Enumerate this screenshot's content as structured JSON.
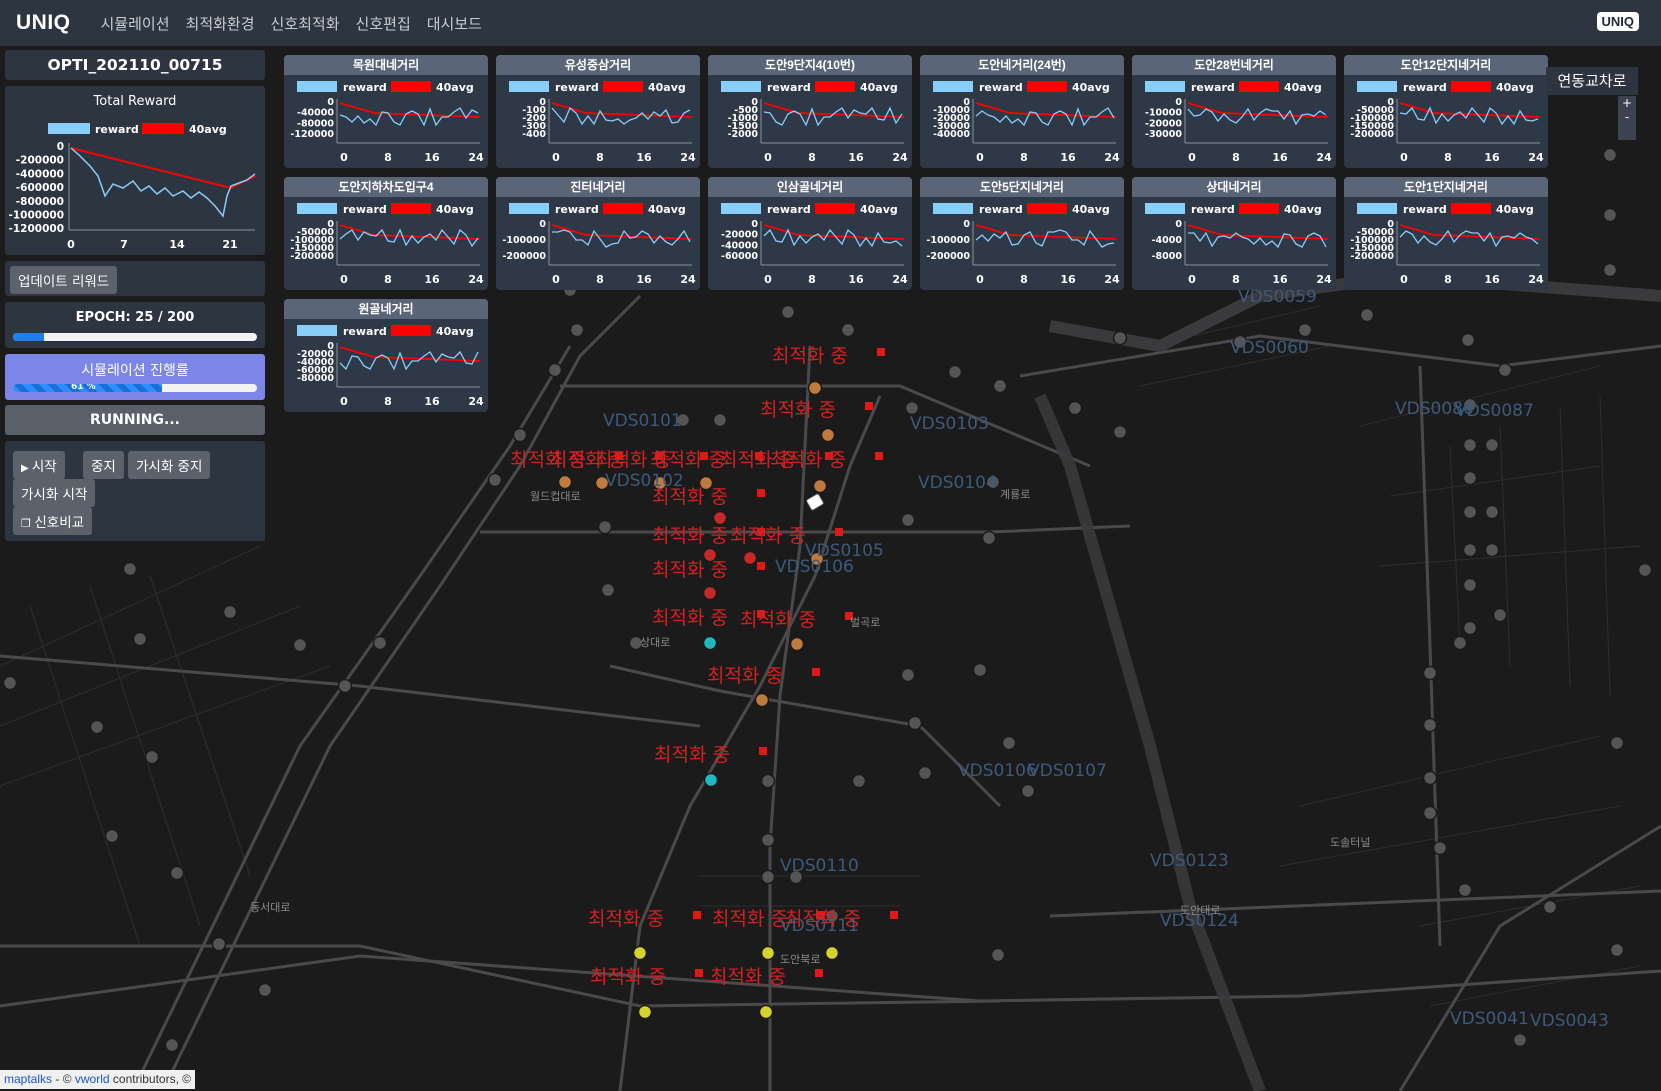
{
  "app": {
    "logo": "UNIQ",
    "badge": "UNIQ"
  },
  "nav": [
    "시뮬레이션",
    "최적화환경",
    "신호최적화",
    "신호편집",
    "대시보드"
  ],
  "sidebar": {
    "run_id": "OPTI_202110_00715",
    "total_reward": {
      "title": "Total Reward",
      "legend": [
        "reward",
        "40avg"
      ],
      "y_ticks": [
        "0",
        "-200000",
        "-400000",
        "-600000",
        "-800000",
        "-1000000",
        "-1200000"
      ],
      "x_ticks": [
        "0",
        "7",
        "14",
        "21"
      ]
    },
    "update_reward_label": "업데이트 리워드",
    "epoch_text": "EPOCH: 25 / 200",
    "epoch_progress": 0.125,
    "sim_progress_title": "시뮬레이션 진행률",
    "sim_progress_text": "61 %",
    "sim_progress": 0.61,
    "status": "RUNNING...",
    "buttons": {
      "start": "시작",
      "stop": "중지",
      "vis_stop": "가시화 중지",
      "vis_start": "가시화 시작",
      "compare": "신호비교"
    }
  },
  "cards": [
    {
      "title": "목원대네거리",
      "y_ticks": [
        "0",
        "-40000",
        "-80000",
        "-120000"
      ]
    },
    {
      "title": "유성중삼거리",
      "y_ticks": [
        "0",
        "-100",
        "-200",
        "-300",
        "-400"
      ]
    },
    {
      "title": "도안9단지4(10번)",
      "y_ticks": [
        "0",
        "-500",
        "-1000",
        "-1500",
        "-2000"
      ]
    },
    {
      "title": "도안네거리(24번)",
      "y_ticks": [
        "0",
        "-10000",
        "-20000",
        "-30000",
        "-40000"
      ]
    },
    {
      "title": "도안28번네거리",
      "y_ticks": [
        "0",
        "-10000",
        "-20000",
        "-30000"
      ]
    },
    {
      "title": "도안12단지네거리",
      "y_ticks": [
        "0",
        "-50000",
        "-100000",
        "-150000",
        "-200000"
      ]
    },
    {
      "title": "도안지하차도입구4",
      "y_ticks": [
        "0",
        "-50000",
        "-100000",
        "-150000",
        "-200000"
      ]
    },
    {
      "title": "진터네거리",
      "y_ticks": [
        "0",
        "-100000",
        "-200000"
      ]
    },
    {
      "title": "인삼골네거리",
      "y_ticks": [
        "0",
        "-20000",
        "-40000",
        "-60000"
      ]
    },
    {
      "title": "도안5단지네거리",
      "y_ticks": [
        "0",
        "-100000",
        "-200000"
      ]
    },
    {
      "title": "상대네거리",
      "y_ticks": [
        "0",
        "-4000",
        "-8000"
      ]
    },
    {
      "title": "도안1단지네거리",
      "y_ticks": [
        "0",
        "-50000",
        "-100000",
        "-150000",
        "-200000"
      ]
    },
    {
      "title": "원골네거리",
      "y_ticks": [
        "0",
        "-20000",
        "-40000",
        "-60000",
        "-80000"
      ]
    }
  ],
  "card_legend": [
    "reward",
    "40avg"
  ],
  "card_x_ticks": [
    "0",
    "8",
    "16",
    "24"
  ],
  "right_tag": "연동교차로",
  "zoom": {
    "in": "+",
    "out": "-"
  },
  "map": {
    "vds_labels": [
      "VDS0101",
      "VDS0103",
      "VDS0102",
      "VDS0104",
      "VDS0105",
      "VDS0106",
      "VDS0059",
      "VDS0060",
      "VDS0086",
      "VDS0087",
      "VDS0106",
      "VDS0107",
      "VDS0123",
      "VDS0124",
      "VDS0110",
      "VDS0111",
      "VDS0041",
      "VDS0043"
    ],
    "optimizing_label": "최적화 중",
    "road_labels": [
      "월드컵대로",
      "계룡로",
      "상대로",
      "동서대로",
      "도안대로",
      "도안북로",
      "벌곡로",
      "도솔터널"
    ]
  },
  "attribution": {
    "a": "maptalks",
    "sep": " - © ",
    "b": "vworld",
    "c": " contributors, ©"
  },
  "colors": {
    "reward": "#87cefa",
    "avg": "#ff0000",
    "accent": "#7b86e6"
  }
}
